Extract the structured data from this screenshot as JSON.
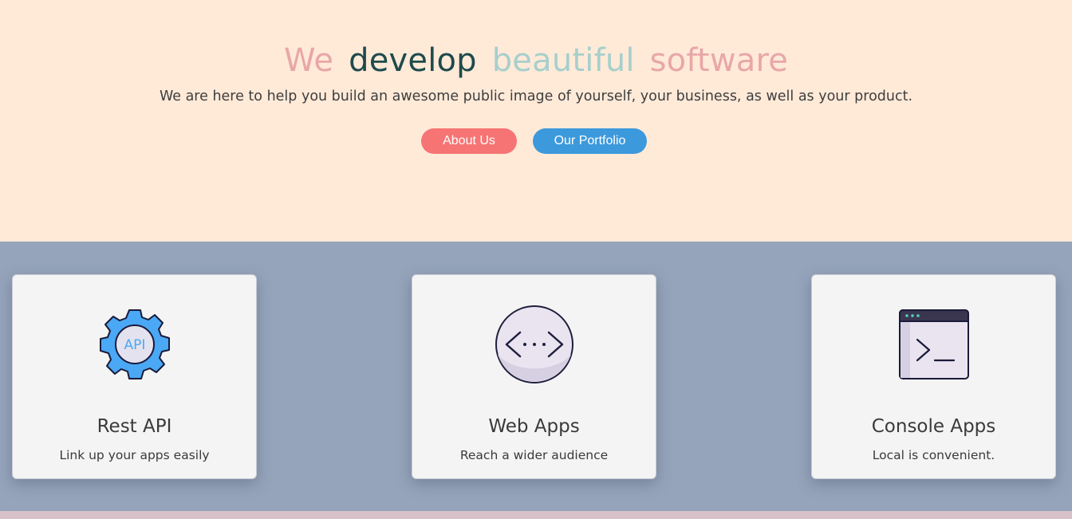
{
  "hero": {
    "headline": {
      "word1": "We",
      "word2": "develop",
      "word3": "beautiful",
      "word4": "software"
    },
    "tagline": "We are here to help you build an awesome public image of yourself, your business, as well as your product.",
    "buttons": {
      "about": "About Us",
      "portfolio": "Our Portfolio"
    }
  },
  "services": [
    {
      "title": "Rest API",
      "description": "Link up your apps easily",
      "icon": "api-gear-icon"
    },
    {
      "title": "Web Apps",
      "description": "Reach a wider audience",
      "icon": "code-brackets-icon"
    },
    {
      "title": "Console Apps",
      "description": "Local is convenient.",
      "icon": "terminal-window-icon"
    }
  ],
  "colors": {
    "hero_bg": "#ffead8",
    "services_bg": "#95a4bb",
    "about_button": "#f77474",
    "portfolio_button": "#3c99dc",
    "headline_pink": "#e8a7a7",
    "headline_dark": "#1e4a4c",
    "headline_teal": "#a7cfcc"
  }
}
